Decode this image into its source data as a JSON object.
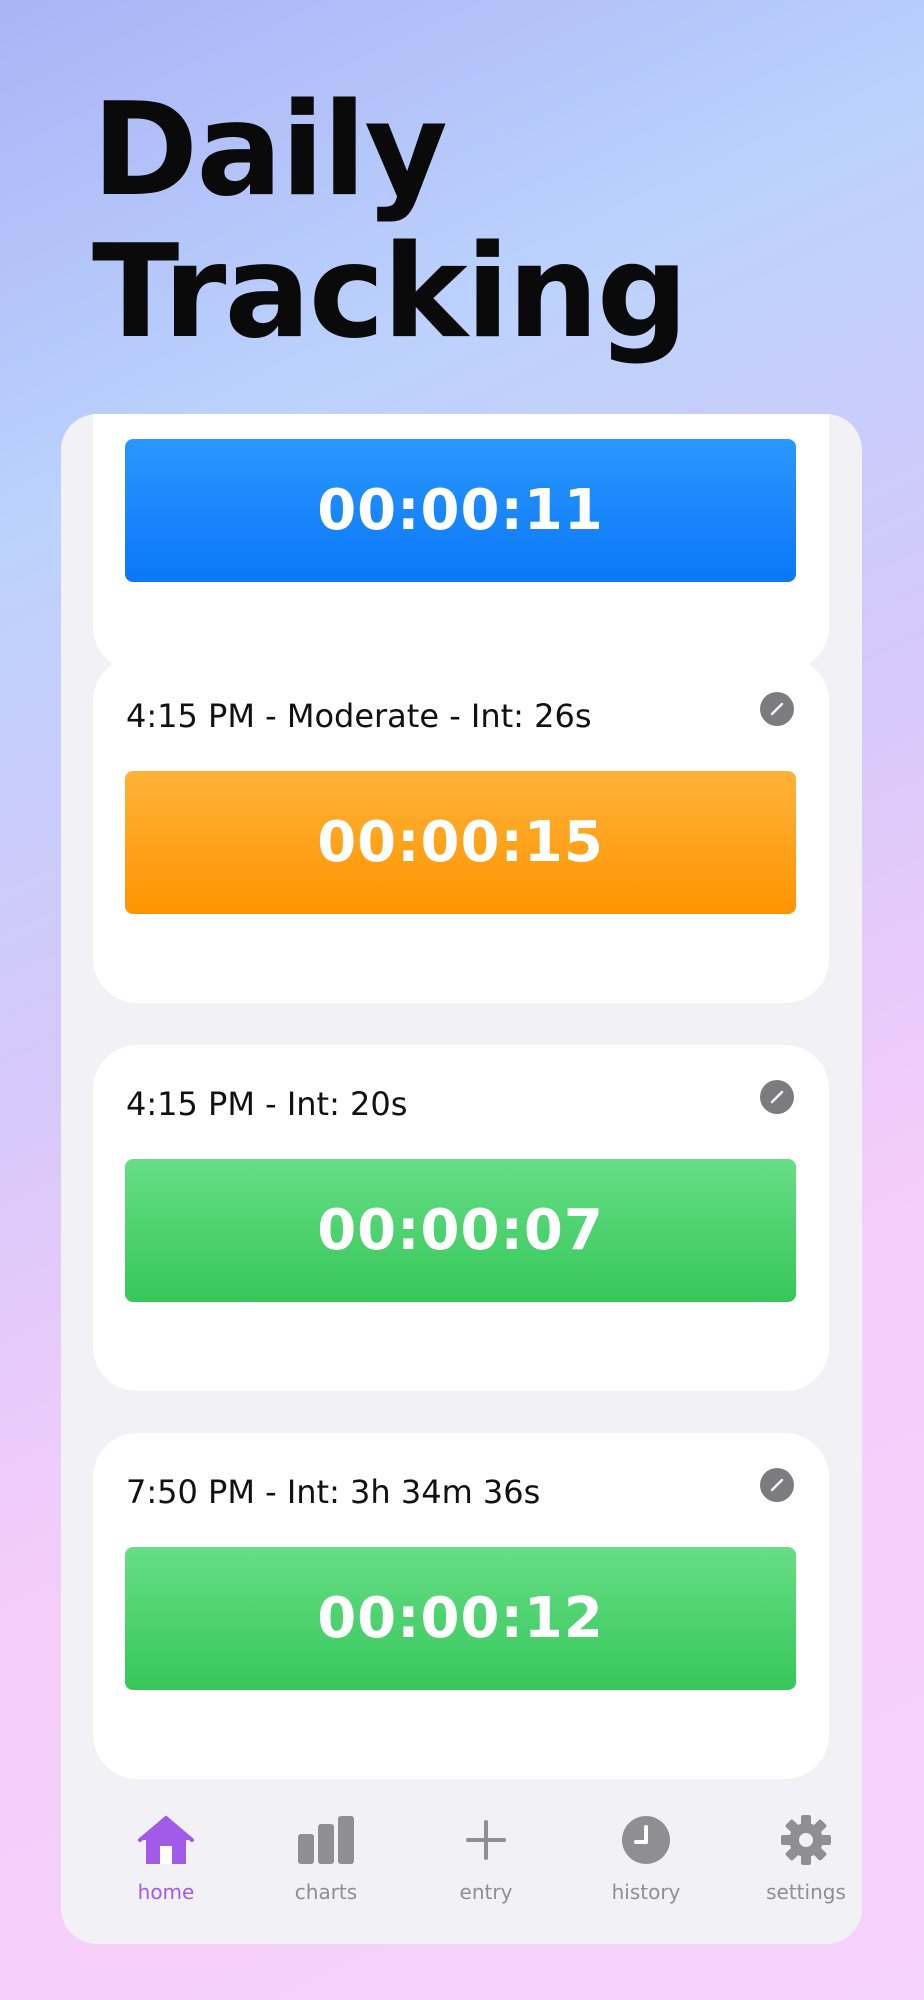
{
  "title_line1": "Daily",
  "title_line2": "Tracking",
  "entries": [
    {
      "label": "",
      "timer": "00:00:11",
      "color": "#0a78f8"
    },
    {
      "label": "4:15 PM - Moderate - Int: 26s",
      "timer": "00:00:15",
      "color": "#ff9400"
    },
    {
      "label": "4:15 PM - Int: 20s",
      "timer": "00:00:07",
      "color": "#36c759"
    },
    {
      "label": "7:50 PM - Int: 3h 34m 36s",
      "timer": "00:00:12",
      "color": "#36c759"
    }
  ],
  "edit_icon": "pencil-circle-icon",
  "tabs": [
    {
      "label": "home",
      "icon": "house-icon",
      "active": true
    },
    {
      "label": "charts",
      "icon": "bar-chart-icon",
      "active": false
    },
    {
      "label": "entry",
      "icon": "plus-icon",
      "active": false
    },
    {
      "label": "history",
      "icon": "clock-icon",
      "active": false
    },
    {
      "label": "settings",
      "icon": "gear-icon",
      "active": false
    }
  ],
  "colors": {
    "accent": "#a15be8",
    "inactive": "#8e8e93"
  }
}
